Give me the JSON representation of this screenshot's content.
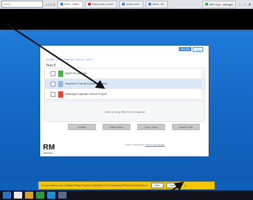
{
  "browser": {
    "address": "ocuz/pc",
    "tabs": [
      {
        "label": "All Fol... Wahkit...",
        "active": true,
        "fav": ""
      },
      {
        "label": "Strays the file to uploa...",
        "active": false,
        "fav": "r"
      },
      {
        "label": "Apptiiiz-ovtus/...",
        "active": false,
        "fav": ""
      },
      {
        "label": "Sticker - Sh...",
        "active": false,
        "fav": ""
      }
    ],
    "right_tab": "OFF Edu - Mtl.login"
  },
  "card": {
    "brand_primary": "RM Unify",
    "brand_secondary": "Apps",
    "breadcrumb": "File Data > Student/Maidstone > Science > Year 8",
    "subtitle": "Year 8",
    "files": [
      {
        "name": "Sig-0D-B1.spbw.doc",
        "icon": "g",
        "selected": false
      },
      {
        "name": "Dispositi-of-Fuel-08 (Cefuelbtvoltalden)",
        "icon": "b",
        "selected": true
      },
      {
        "name": "Heterotype Organism Science R Inpolt",
        "icon": "r",
        "selected": false
      }
    ],
    "drop_text": "Click or drop files here to upload",
    "buttons": [
      "Upload",
      "Delete Items",
      "Copy / Move",
      "Create Folder"
    ],
    "logo": "RM",
    "logo_sub": "Education",
    "footer_prefix": "Need to upload files:",
    "footer_link": "Intercom FileUploads"
  },
  "notice": {
    "text": "Do you want to save Cafdited-PAing-Physics-Cevaluation-8 (1) Evaluating Reference.lexicuit.docx?",
    "save_label": "Save",
    "cancel_label": "Cancel"
  }
}
